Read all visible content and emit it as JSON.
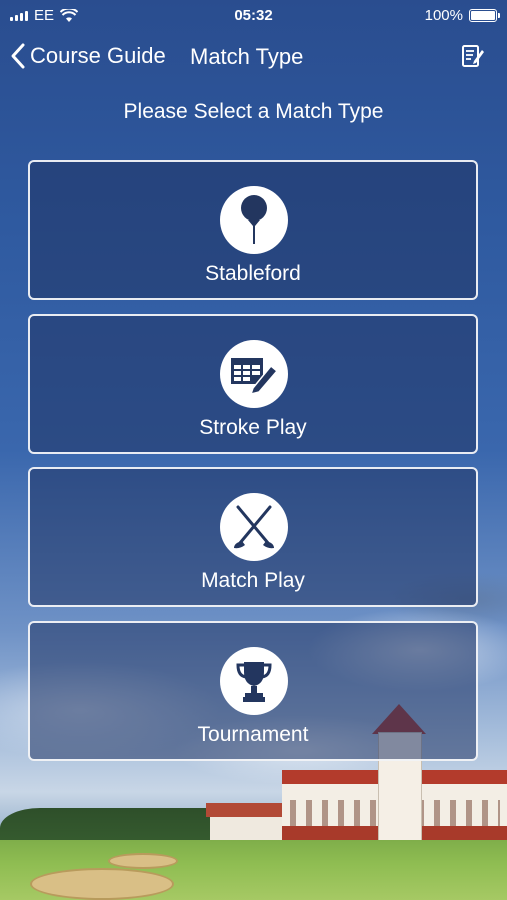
{
  "status_bar": {
    "carrier": "EE",
    "time": "05:32",
    "battery": "100%"
  },
  "nav": {
    "back_label": "Course Guide",
    "title": "Match Type",
    "icons": {
      "back": "chevron-left-icon",
      "edit": "edit-note-icon"
    }
  },
  "subtitle": "Please Select a Match Type",
  "match_types": [
    {
      "label": "Stableford",
      "icon": "golf-tee-icon"
    },
    {
      "label": "Stroke Play",
      "icon": "scorecard-edit-icon"
    },
    {
      "label": "Match Play",
      "icon": "crossed-clubs-icon"
    },
    {
      "label": "Tournament",
      "icon": "trophy-icon"
    }
  ],
  "colors": {
    "card_border": "#ffffff",
    "icon_color": "#23365f"
  }
}
